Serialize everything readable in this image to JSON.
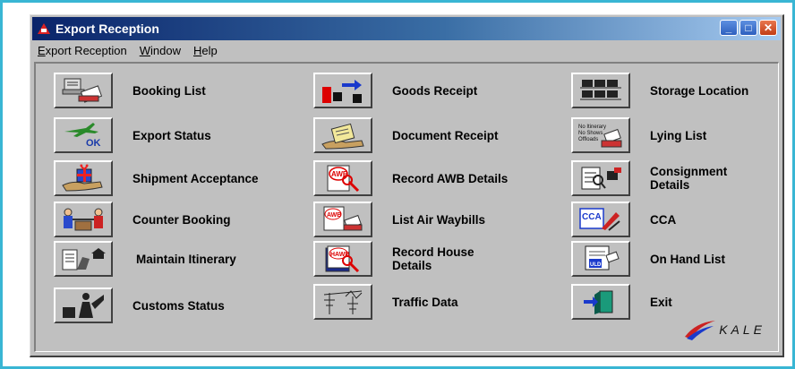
{
  "window": {
    "title": "Export Reception",
    "controls": {
      "minimize": "_",
      "maximize": "□",
      "close": "✕"
    }
  },
  "menu": {
    "export_reception": {
      "first": "E",
      "rest": "xport Reception"
    },
    "window": {
      "first": "W",
      "rest": "indow"
    },
    "help": {
      "first": "H",
      "rest": "elp"
    }
  },
  "functions": {
    "col1": [
      {
        "label": "Booking List",
        "icon": "booking-list-icon"
      },
      {
        "label": "Export Status",
        "icon": "export-status-icon"
      },
      {
        "label": "Shipment Acceptance",
        "icon": "shipment-acceptance-icon"
      },
      {
        "label": "Counter Booking",
        "icon": "counter-booking-icon"
      },
      {
        "label": "Maintain Itinerary",
        "icon": "maintain-itinerary-icon"
      },
      {
        "label": "Customs Status",
        "icon": "customs-status-icon"
      }
    ],
    "col2": [
      {
        "label": "Goods Receipt",
        "icon": "goods-receipt-icon"
      },
      {
        "label": "Document Receipt",
        "icon": "document-receipt-icon"
      },
      {
        "label": "Record AWB Details",
        "icon": "record-awb-icon"
      },
      {
        "label": "List Air Waybills",
        "icon": "list-air-waybills-icon"
      },
      {
        "label": "Record House Details",
        "icon": "record-house-icon"
      },
      {
        "label": "Traffic Data",
        "icon": "traffic-data-icon"
      }
    ],
    "col3": [
      {
        "label": "Storage Location",
        "icon": "storage-location-icon"
      },
      {
        "label": "Lying List",
        "icon": "lying-list-icon"
      },
      {
        "label": "Consignment Details",
        "icon": "consignment-details-icon"
      },
      {
        "label": "CCA",
        "icon": "cca-icon"
      },
      {
        "label": "On Hand List",
        "icon": "on-hand-list-icon"
      },
      {
        "label": "Exit",
        "icon": "exit-door-icon"
      }
    ]
  },
  "icon_text": {
    "ok": "OK",
    "awb": "AWB",
    "hawb": "HAWB",
    "lying": [
      "No Itinerary",
      "No Shows",
      "Offloads"
    ],
    "cca": "CCA",
    "uld": "ULD"
  },
  "logo": {
    "text": "KALE"
  },
  "colors": {
    "title_start": "#0a246a",
    "title_end": "#a6caf0",
    "face": "#c0c0c0",
    "frame": "#39b6d4"
  }
}
